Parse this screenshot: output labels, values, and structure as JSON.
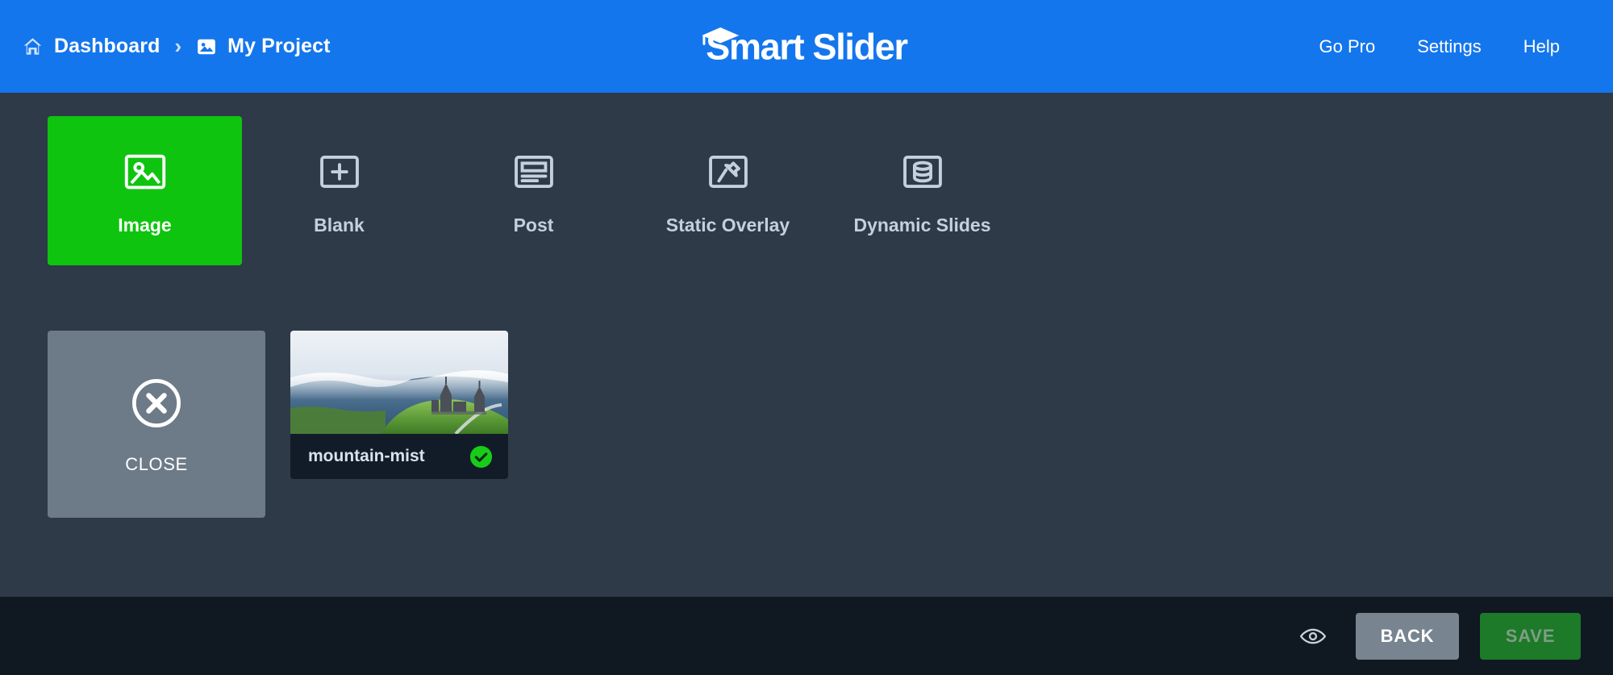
{
  "header": {
    "breadcrumb": [
      {
        "label": "Dashboard",
        "icon": "home-icon"
      },
      {
        "label": "My Project",
        "icon": "image-icon"
      }
    ],
    "separator": "›",
    "logo": {
      "text": "Smart Slider",
      "icon": "graduation-cap-icon"
    },
    "nav": [
      {
        "label": "Go Pro"
      },
      {
        "label": "Settings"
      },
      {
        "label": "Help"
      }
    ],
    "background": "#1476ec"
  },
  "slide_types": [
    {
      "label": "Image",
      "icon": "image-icon",
      "active": true
    },
    {
      "label": "Blank",
      "icon": "plus-icon",
      "active": false
    },
    {
      "label": "Post",
      "icon": "post-icon",
      "active": false
    },
    {
      "label": "Static Overlay",
      "icon": "pushpin-icon",
      "active": false
    },
    {
      "label": "Dynamic Slides",
      "icon": "database-icon",
      "active": false
    }
  ],
  "slides": {
    "close_tile": {
      "label": "CLOSE",
      "icon": "close-circle-icon"
    },
    "items": [
      {
        "title": "mountain-mist",
        "selected": true,
        "badge_icon": "check-circle-icon"
      }
    ]
  },
  "footer": {
    "preview_icon": "eye-icon",
    "back_label": "BACK",
    "save_label": "SAVE"
  },
  "colors": {
    "accent_blue": "#1476ec",
    "accent_green": "#0fc40f",
    "background": "#2e3a47",
    "footer_background": "#101822",
    "card_background": "#121c28",
    "muted_tile": "#6d7a88",
    "save_green": "#1c7a28",
    "back_grey": "#78848f",
    "icon_grey": "#c4d0dc"
  }
}
